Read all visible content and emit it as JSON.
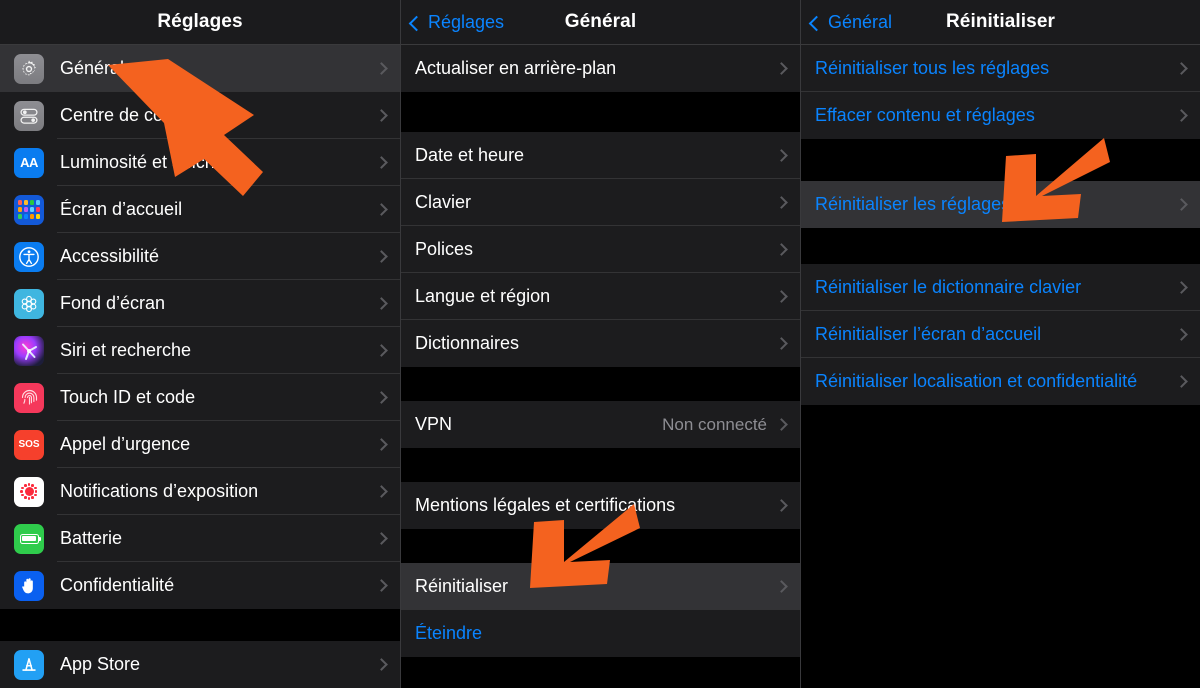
{
  "panels": {
    "settings": {
      "nav": {
        "title": "Réglages"
      },
      "groups": [
        {
          "items": [
            {
              "label": "Général",
              "icon": "gear-icon",
              "selected": true,
              "chevron": true
            },
            {
              "label": "Centre de contrôle",
              "icon": "control-center-icon",
              "selected": false,
              "chevron": true
            },
            {
              "label": "Luminosité et affichage",
              "icon": "display-brightness-icon",
              "selected": false,
              "chevron": true
            },
            {
              "label": "Écran d’accueil",
              "icon": "home-screen-icon",
              "selected": false,
              "chevron": true
            },
            {
              "label": "Accessibilité",
              "icon": "accessibility-icon",
              "selected": false,
              "chevron": true
            },
            {
              "label": "Fond d’écran",
              "icon": "wallpaper-icon",
              "selected": false,
              "chevron": true
            },
            {
              "label": "Siri et recherche",
              "icon": "siri-icon",
              "selected": false,
              "chevron": true
            },
            {
              "label": "Touch ID et code",
              "icon": "touch-id-icon",
              "selected": false,
              "chevron": true
            },
            {
              "label": "Appel d’urgence",
              "icon": "sos-icon",
              "selected": false,
              "chevron": true
            },
            {
              "label": "Notifications d’exposition",
              "icon": "exposure-notifications-icon",
              "selected": false,
              "chevron": true
            },
            {
              "label": "Batterie",
              "icon": "battery-icon",
              "selected": false,
              "chevron": true
            },
            {
              "label": "Confidentialité",
              "icon": "privacy-hand-icon",
              "selected": false,
              "chevron": true
            }
          ]
        },
        {
          "items": [
            {
              "label": "App Store",
              "icon": "app-store-icon",
              "selected": false,
              "chevron": true
            }
          ]
        }
      ]
    },
    "general": {
      "nav": {
        "back_label": "Réglages",
        "title": "Général"
      },
      "groups": [
        {
          "items": [
            {
              "label": "Actualiser en arrière-plan",
              "chevron": true
            }
          ]
        },
        {
          "items": [
            {
              "label": "Date et heure",
              "chevron": true
            },
            {
              "label": "Clavier",
              "chevron": true
            },
            {
              "label": "Polices",
              "chevron": true
            },
            {
              "label": "Langue et région",
              "chevron": true
            },
            {
              "label": "Dictionnaires",
              "chevron": true
            }
          ]
        },
        {
          "items": [
            {
              "label": "VPN",
              "value": "Non connecté",
              "chevron": true
            }
          ]
        },
        {
          "items": [
            {
              "label": "Mentions légales et certifications",
              "chevron": true
            }
          ]
        },
        {
          "items": [
            {
              "label": "Réinitialiser",
              "selected": true,
              "chevron": true
            },
            {
              "label": "Éteindre",
              "blue": true,
              "chevron": false
            }
          ]
        }
      ]
    },
    "reset": {
      "nav": {
        "back_label": "Général",
        "title": "Réinitialiser"
      },
      "groups": [
        {
          "items": [
            {
              "label": "Réinitialiser tous les réglages",
              "blue": true
            },
            {
              "label": "Effacer contenu et réglages",
              "blue": true
            }
          ]
        },
        {
          "items": [
            {
              "label": "Réinitialiser les réglages réseau",
              "blue": true,
              "selected": true
            }
          ]
        },
        {
          "items": [
            {
              "label": "Réinitialiser le dictionnaire clavier",
              "blue": true
            },
            {
              "label": "Réinitialiser l’écran d’accueil",
              "blue": true
            },
            {
              "label": "Réinitialiser localisation et confidentialité",
              "blue": true
            }
          ]
        }
      ]
    }
  },
  "annotations": {
    "arrows": [
      {
        "name": "arrow-to-general",
        "points_to": "Général",
        "direction": "up-left",
        "color": "#f4621f"
      },
      {
        "name": "arrow-to-reinitialiser",
        "points_to": "Réinitialiser",
        "direction": "down-left",
        "color": "#f4621f"
      },
      {
        "name": "arrow-to-network-reset",
        "points_to": "Réinitialiser les réglages réseau",
        "direction": "down-left",
        "color": "#f4621f"
      }
    ]
  },
  "colors": {
    "accent_blue": "#0a84ff",
    "arrow_orange": "#f4621f",
    "row_bg": "#1c1c1e",
    "row_selected_bg": "#333336",
    "page_bg": "#000000"
  }
}
